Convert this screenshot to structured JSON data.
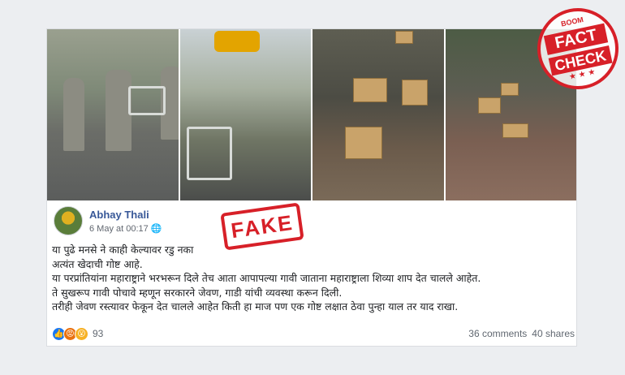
{
  "post": {
    "author": "Abhay Thali",
    "timestamp": "6 May at 00:17",
    "privacy_icon": "globe-icon",
    "text_lines": [
      "या पुढे मनसे ने काही केल्यावर रडु नका",
      "अत्यंत खेदाची गोष्ट आहे.",
      "या परप्रांतियांना महाराष्ट्राने भरभरून दिले तेच आता आपापल्या गावी जाताना महाराष्ट्राला शिव्या शाप देत चालले आहेत.",
      "ते सुखरूप गावी पोचावे म्हणून सरकारने जेवण, गाडी यांची व्यवस्था करून दिली.",
      "तरीही जेवण रस्त्यावर फेकून देत चालले आहेत किती हा माज पण एक गोष्ट लक्षात ठेवा पुन्हा याल तर याद राखा."
    ],
    "reaction_icons": [
      "like-icon",
      "angry-icon",
      "wow-icon"
    ],
    "reaction_count": "93",
    "comments": "36 comments",
    "shares": "40 shares"
  },
  "stamp": {
    "text": "FAKE",
    "color": "#d72028"
  },
  "badge": {
    "brand": "BOOM",
    "line1": "FACT",
    "line2": "CHECK",
    "stars": "★★★"
  },
  "colors": {
    "author_link": "#385898",
    "like": "#1877f2",
    "stamp_red": "#d72028"
  }
}
